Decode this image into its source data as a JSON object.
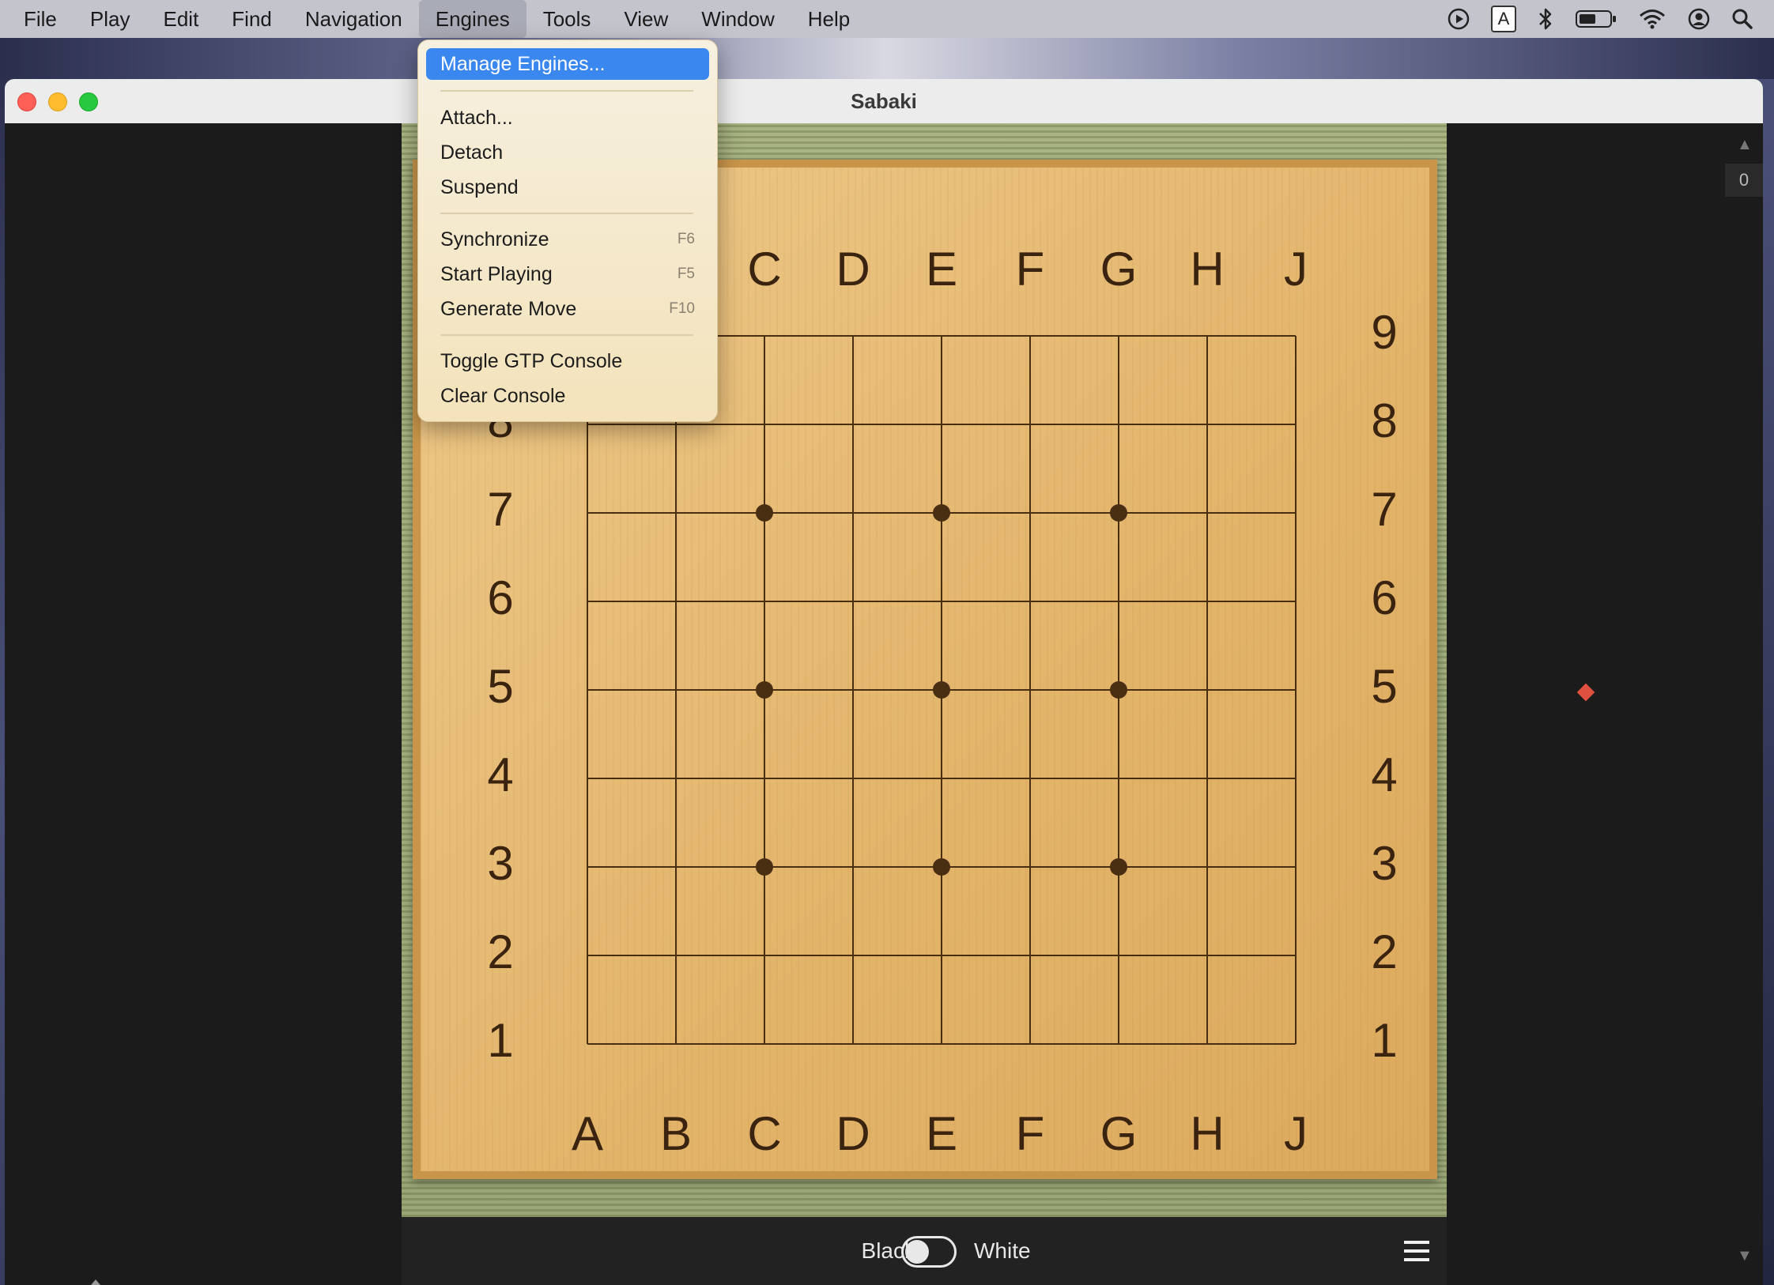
{
  "menubar": {
    "items": [
      "File",
      "Play",
      "Edit",
      "Find",
      "Navigation",
      "Engines",
      "Tools",
      "View",
      "Window",
      "Help"
    ],
    "active": "Engines"
  },
  "status_icons": [
    "play-circle-icon",
    "input-source-icon",
    "bluetooth-icon",
    "battery-icon",
    "wifi-icon",
    "user-icon",
    "search-icon"
  ],
  "input_source_letter": "A",
  "window": {
    "title": "Sabaki"
  },
  "engines_menu": {
    "items": [
      {
        "label": "Manage Engines...",
        "shortcut": "",
        "highlighted": true
      },
      {
        "label": "Attach...",
        "shortcut": ""
      },
      {
        "label": "Detach",
        "shortcut": ""
      },
      {
        "label": "Suspend",
        "shortcut": ""
      },
      {
        "label": "Synchronize",
        "shortcut": "F6"
      },
      {
        "label": "Start Playing",
        "shortcut": "F5"
      },
      {
        "label": "Generate Move",
        "shortcut": "F10"
      },
      {
        "label": "Toggle GTP Console",
        "shortcut": ""
      },
      {
        "label": "Clear Console",
        "shortcut": ""
      }
    ]
  },
  "board": {
    "size": 9,
    "columns": [
      "A",
      "B",
      "C",
      "D",
      "E",
      "F",
      "G",
      "H",
      "J"
    ],
    "rows": [
      "9",
      "8",
      "7",
      "6",
      "5",
      "4",
      "3",
      "2",
      "1"
    ],
    "star_points": [
      "C7",
      "E7",
      "G7",
      "C5",
      "E5",
      "G5",
      "C3",
      "E3",
      "G3"
    ]
  },
  "bottom_bar": {
    "black_label": "Black",
    "white_label": "White"
  },
  "right_panel": {
    "counter": "0"
  },
  "colors": {
    "accent": "#3b87f0",
    "board": "#e6b96e",
    "marker": "#e05040"
  }
}
